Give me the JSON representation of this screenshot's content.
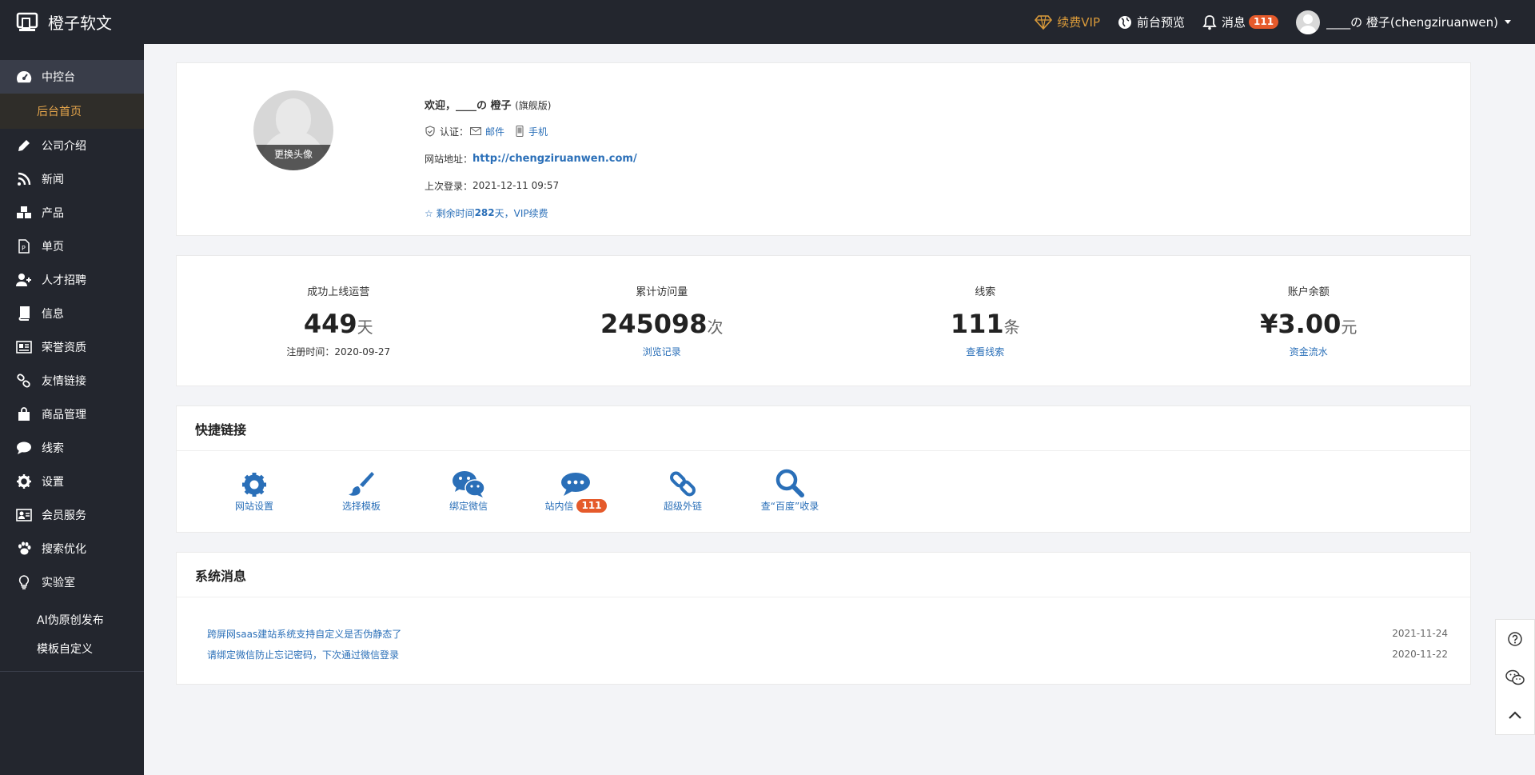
{
  "brand": {
    "name": "橙子软文"
  },
  "topbar": {
    "vip": "续费VIP",
    "preview": "前台预览",
    "messages": "消息",
    "messages_count": "111",
    "user": "____の 橙子(chengziruanwen)"
  },
  "sidebar": {
    "dashboard": "中控台",
    "dashboard_sub": "后台首页",
    "items": [
      {
        "label": "公司介绍",
        "icon": "pencil-icon"
      },
      {
        "label": "新闻",
        "icon": "rss-icon"
      },
      {
        "label": "产品",
        "icon": "cubes-icon"
      },
      {
        "label": "单页",
        "icon": "page-icon"
      },
      {
        "label": "人才招聘",
        "icon": "user-plus-icon"
      },
      {
        "label": "信息",
        "icon": "book-icon"
      },
      {
        "label": "荣誉资质",
        "icon": "newspaper-icon"
      },
      {
        "label": "友情链接",
        "icon": "link-icon"
      },
      {
        "label": "商品管理",
        "icon": "shopping-bag-icon"
      },
      {
        "label": "线索",
        "icon": "comment-icon"
      },
      {
        "label": "设置",
        "icon": "gear-icon"
      },
      {
        "label": "会员服务",
        "icon": "id-card-icon"
      },
      {
        "label": "搜索优化",
        "icon": "paw-icon"
      },
      {
        "label": "实验室",
        "icon": "lightbulb-icon"
      }
    ],
    "lab_subs": [
      "AI伪原创发布",
      "模板自定义"
    ]
  },
  "profile": {
    "change_avatar": "更换头像",
    "welcome": "欢迎，____の 橙子",
    "edition": "(旗舰版)",
    "verify_label": "认证：",
    "verify_email": "邮件",
    "verify_phone": "手机",
    "site_label": "网站地址：",
    "site_url": "http://chengziruanwen.com/",
    "last_login_label": "上次登录：",
    "last_login": "2021-12-11 09:57",
    "remain_prefix": "☆ 剩余时间",
    "remain_days": "282",
    "remain_suffix": "天，VIP续费"
  },
  "stats": [
    {
      "title": "成功上线运营",
      "value": "449",
      "unit": "天",
      "sub": "注册时间：2020-09-27"
    },
    {
      "title": "累计访问量",
      "value": "245098",
      "unit": "次",
      "sub": "浏览记录"
    },
    {
      "title": "线索",
      "value": "111",
      "unit": "条",
      "sub": "查看线索"
    },
    {
      "title": "账户余额",
      "value": "¥3.00",
      "unit": "元",
      "sub": "资金流水"
    }
  ],
  "quick": {
    "title": "快捷链接",
    "items": [
      {
        "label": "网站设置",
        "icon": "gear-icon"
      },
      {
        "label": "选择模板",
        "icon": "paintbrush-icon"
      },
      {
        "label": "绑定微信",
        "icon": "wechat-icon"
      },
      {
        "label": "站内信",
        "icon": "chat-bubble-icon",
        "badge": "111"
      },
      {
        "label": "超级外链",
        "icon": "link-icon"
      },
      {
        "label": "查“百度”收录",
        "icon": "search-icon"
      }
    ]
  },
  "system": {
    "title": "系统消息",
    "messages": [
      {
        "text": "跨屏网saas建站系统支持自定义是否伪静态了",
        "date": "2021-11-24"
      },
      {
        "text": "请绑定微信防止忘记密码，下次通过微信登录",
        "date": "2020-11-22"
      }
    ]
  },
  "colors": {
    "topbar": "#23262e",
    "sidebar": "#23262e",
    "active": "#393d49",
    "accent": "#e5a54b",
    "link": "#2a6fb8",
    "badge": "#e55a2b"
  }
}
